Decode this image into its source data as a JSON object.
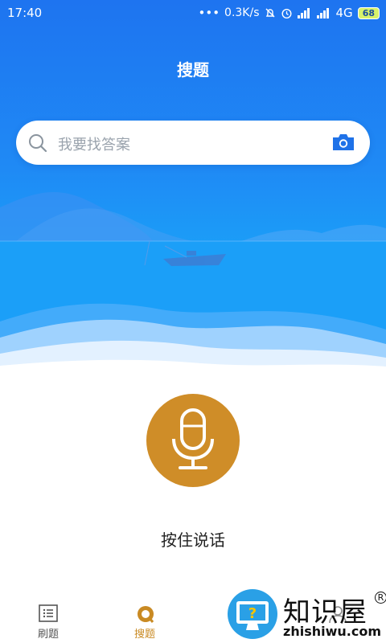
{
  "status_bar": {
    "time": "17:40",
    "dots": "•••",
    "network_speed": "0.3K/s",
    "network_type": "4G",
    "battery": "68"
  },
  "header": {
    "title": "搜题"
  },
  "search": {
    "placeholder": "我要找答案",
    "icon": "search-icon",
    "camera_icon": "camera-icon"
  },
  "voice": {
    "label": "按住说话",
    "icon": "microphone-icon"
  },
  "tabbar": {
    "items": [
      {
        "label": "刷题",
        "icon": "list-icon",
        "active": false
      },
      {
        "label": "搜题",
        "icon": "search-circle-icon",
        "active": true
      },
      {
        "label": "",
        "icon": "hidden-tab-icon",
        "active": false
      },
      {
        "label": "",
        "icon": "person-icon",
        "active": false
      }
    ]
  },
  "watermark": {
    "title": "知识屋",
    "subtitle": "zhishiwu.com"
  },
  "colors": {
    "hero_blue": "#1e7ff2",
    "accent_gold": "#cf8d28",
    "active_tab": "#c98a23"
  }
}
